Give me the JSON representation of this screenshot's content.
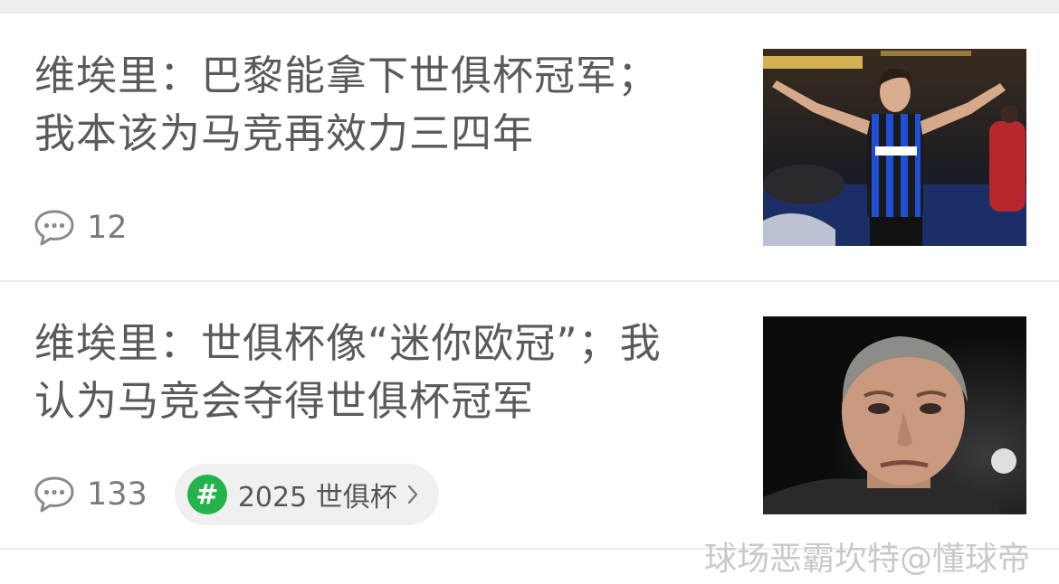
{
  "articles": [
    {
      "title_line1": "维埃里：巴黎能拿下世俱杯冠军；",
      "title_line2": "我本该为马竞再效力三四年",
      "comment_count": "12",
      "comment_icon": "comment-bubble-icon",
      "thumbnail": "player-celebrating-photo"
    },
    {
      "title_line1": "维埃里：世俱杯像“迷你欧冠”；我",
      "title_line2": "认为马竞会夺得世俱杯冠军",
      "comment_count": "133",
      "comment_icon": "comment-bubble-icon",
      "tag": {
        "symbol": "#",
        "label": "2025 世俱杯",
        "chevron": "chevron-right-icon",
        "accent": "#24b24a"
      },
      "thumbnail": "portrait-photo"
    }
  ],
  "watermark": "球场恶霸坎特@懂球帝",
  "colors": {
    "title": "#5a5a5a",
    "meta": "#7a7a7a",
    "tag_bg": "#f0f0f1",
    "divider": "#ececec"
  }
}
